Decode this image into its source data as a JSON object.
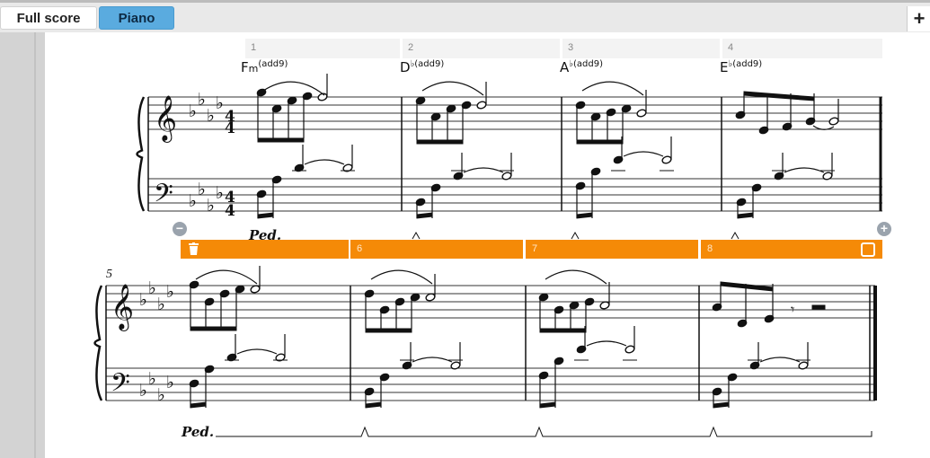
{
  "tabs": [
    {
      "label": "Full score"
    },
    {
      "label": "Piano"
    }
  ],
  "add_tab_label": "+",
  "bar_numbers": [
    "1",
    "2",
    "3",
    "4"
  ],
  "chords": [
    {
      "root": "F",
      "suffix": "m",
      "ext": "(add9)"
    },
    {
      "root": "D",
      "suffix": "♭",
      "ext": "(add9)"
    },
    {
      "root": "A",
      "suffix": "♭",
      "ext": "(add9)"
    },
    {
      "root": "E",
      "suffix": "♭",
      "ext": "(add9)"
    }
  ],
  "selection_bars": [
    "",
    "6",
    "7",
    "8"
  ],
  "system2_bar_number": "5",
  "pedal_marking": "Ped.",
  "time_signature": {
    "top": "4",
    "bottom": "4"
  },
  "remove_icon": "minus-circle-icon",
  "add_icon": "plus-circle-icon",
  "colors": {
    "selection": "#f58a07",
    "active_tab": "#5aabdf"
  }
}
